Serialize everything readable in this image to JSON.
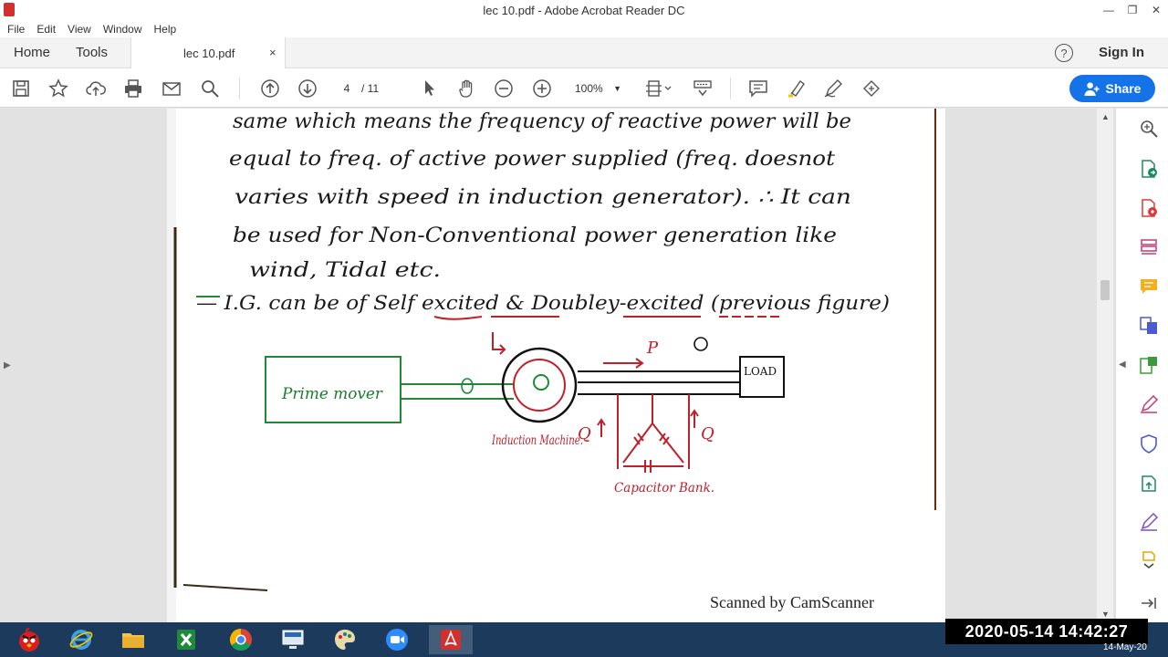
{
  "window": {
    "title": "lec 10.pdf - Adobe Acrobat Reader DC",
    "controls": [
      "—",
      "❐",
      "✕"
    ]
  },
  "menu": [
    "File",
    "Edit",
    "View",
    "Window",
    "Help"
  ],
  "tabs": {
    "home": "Home",
    "tools": "Tools",
    "document": "lec 10.pdf",
    "close": "×",
    "help": "?",
    "signin": "Sign In"
  },
  "toolbar": {
    "page_current": "4",
    "page_total": "/ 11",
    "zoom": "100%",
    "share_label": "Share",
    "colors": {
      "accent": "#1473e6",
      "highlighter": "#f5c400"
    }
  },
  "document": {
    "handwritten_lines": [
      "same which means the frequency of reactive power will be",
      "equal to freq. of active power supplied (freq. doesnot",
      "varies with speed in induction generator). ∴ It can",
      "be used for Non-Conventional power generation like",
      "wind, Tidal etc.",
      "— I.G. can be of Self excited & Doubley-excited (previous figure)"
    ],
    "diagram_labels": {
      "prime_mover": "Prime mover",
      "load": "LOAD",
      "induction_machine": "Induction Machine.",
      "capacitor_bank": "Capacitor Bank.",
      "p": "P",
      "q_left": "Q",
      "q_right": "Q"
    },
    "footer": "Scanned by CamScanner"
  },
  "right_panel_icons": [
    "zoom-icon",
    "export-pdf-icon",
    "create-pdf-icon",
    "organize-pages-icon",
    "comment-icon",
    "combine-files-icon",
    "edit-pdf-icon",
    "fill-sign-icon",
    "protect-icon",
    "send-track-icon",
    "sign-icon",
    "more-tools-icon"
  ],
  "taskbar": {
    "clock": "2020-05-14  14:42:27",
    "date": "14-May-20",
    "apps": [
      "angry-birds-icon",
      "internet-explorer-icon",
      "file-explorer-icon",
      "excel-icon",
      "chrome-icon",
      "lenovo-icon",
      "paint-icon",
      "zoom-app-icon",
      "acrobat-icon"
    ]
  }
}
